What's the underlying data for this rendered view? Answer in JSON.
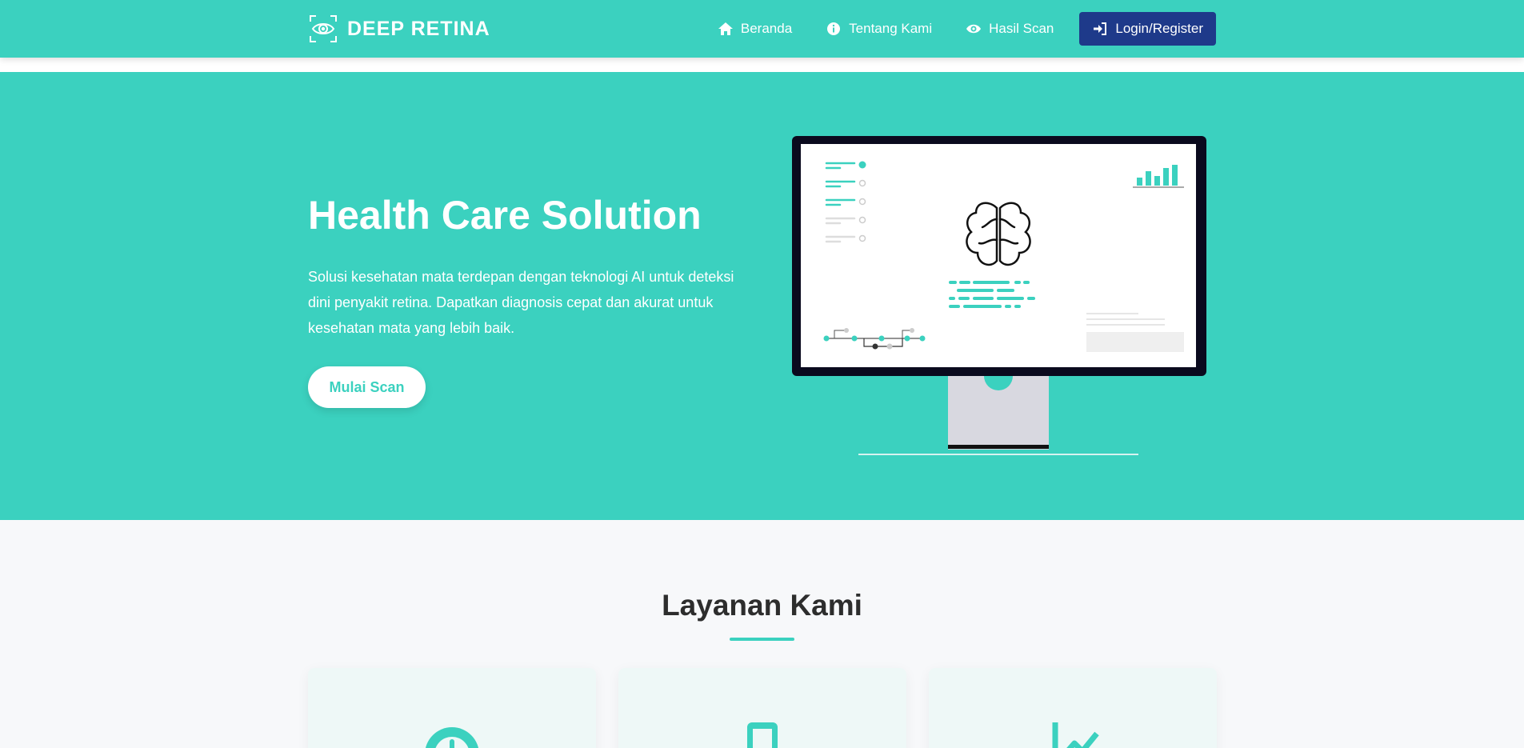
{
  "navbar": {
    "brand": "DEEP RETINA",
    "items": [
      {
        "label": "Beranda",
        "icon": "home-icon"
      },
      {
        "label": "Tentang Kami",
        "icon": "info-icon"
      },
      {
        "label": "Hasil Scan",
        "icon": "eye-icon"
      }
    ],
    "login_label": "Login/Register",
    "login_icon": "sign-in-icon"
  },
  "hero": {
    "title": "Health Care Solution",
    "description": "Solusi kesehatan mata terdepan dengan teknologi AI untuk deteksi dini penyakit retina. Dapatkan diagnosis cepat dan akurat untuk kesehatan mata yang lebih baik.",
    "cta_label": "Mulai Scan",
    "illustration": "monitor-brain-illustration"
  },
  "services": {
    "title": "Layanan Kami",
    "cards": [
      {
        "icon": "clock-icon"
      },
      {
        "icon": "mobile-icon"
      },
      {
        "icon": "chart-line-icon"
      }
    ]
  },
  "colors": {
    "primary": "#3bd1bf",
    "login_button": "#1e3a8a",
    "background": "#f7f8fa",
    "heading": "#2d2d2d"
  }
}
